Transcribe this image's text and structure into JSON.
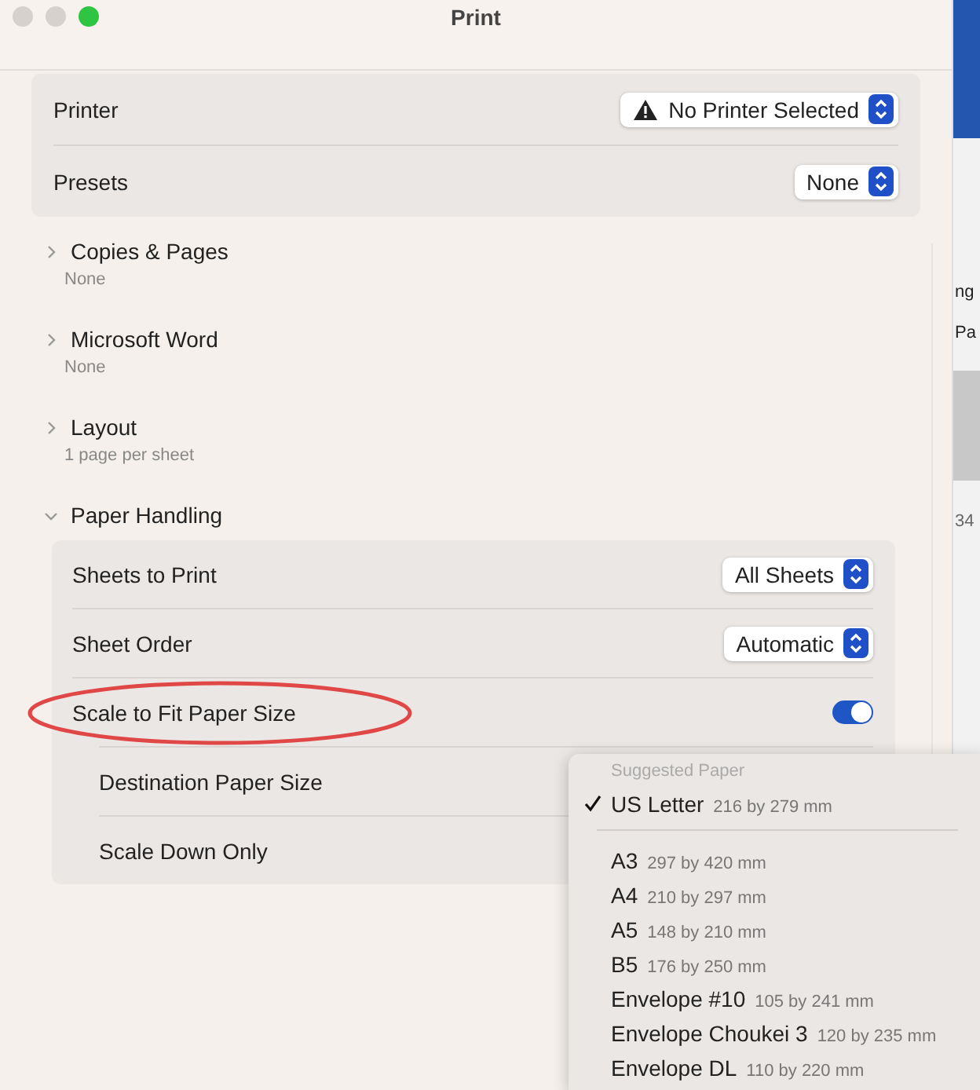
{
  "window": {
    "title": "Print"
  },
  "top_settings": [
    {
      "label": "Printer",
      "value": "No Printer Selected",
      "warning": true
    },
    {
      "label": "Presets",
      "value": "None",
      "warning": false
    }
  ],
  "sections": [
    {
      "title": "Copies & Pages",
      "summary": "None",
      "expanded": false
    },
    {
      "title": "Microsoft Word",
      "summary": "None",
      "expanded": false
    },
    {
      "title": "Layout",
      "summary": "1 page per sheet",
      "expanded": false
    },
    {
      "title": "Paper Handling",
      "expanded": true
    }
  ],
  "paper_handling": [
    {
      "kind": "popup",
      "label": "Sheets to Print",
      "value": "All Sheets",
      "indented": false
    },
    {
      "kind": "popup",
      "label": "Sheet Order",
      "value": "Automatic",
      "indented": false
    },
    {
      "kind": "toggle",
      "label": "Scale to Fit Paper Size",
      "on": true,
      "indented": false,
      "circled": true
    },
    {
      "kind": "plain",
      "label": "Destination Paper Size",
      "indented": true
    },
    {
      "kind": "plain",
      "label": "Scale Down Only",
      "indented": true
    }
  ],
  "paper_menu": {
    "header": "Suggested Paper",
    "groups": [
      {
        "items": [
          {
            "name": "US Letter",
            "size": "216 by 279 mm",
            "selected": true
          }
        ]
      },
      {
        "items": [
          {
            "name": "A3",
            "size": "297 by 420 mm",
            "selected": false
          },
          {
            "name": "A4",
            "size": "210 by 297 mm",
            "selected": false
          },
          {
            "name": "A5",
            "size": "148 by 210 mm",
            "selected": false
          },
          {
            "name": "B5",
            "size": "176 by 250 mm",
            "selected": false
          },
          {
            "name": "Envelope #10",
            "size": "105 by 241 mm",
            "selected": false
          },
          {
            "name": "Envelope Choukei 3",
            "size": "120 by 235 mm",
            "selected": false
          },
          {
            "name": "Envelope DL",
            "size": "110 by 220 mm",
            "selected": false
          }
        ]
      }
    ]
  },
  "background_window": {
    "fragments": [
      "ng",
      "Pa",
      "34"
    ]
  }
}
